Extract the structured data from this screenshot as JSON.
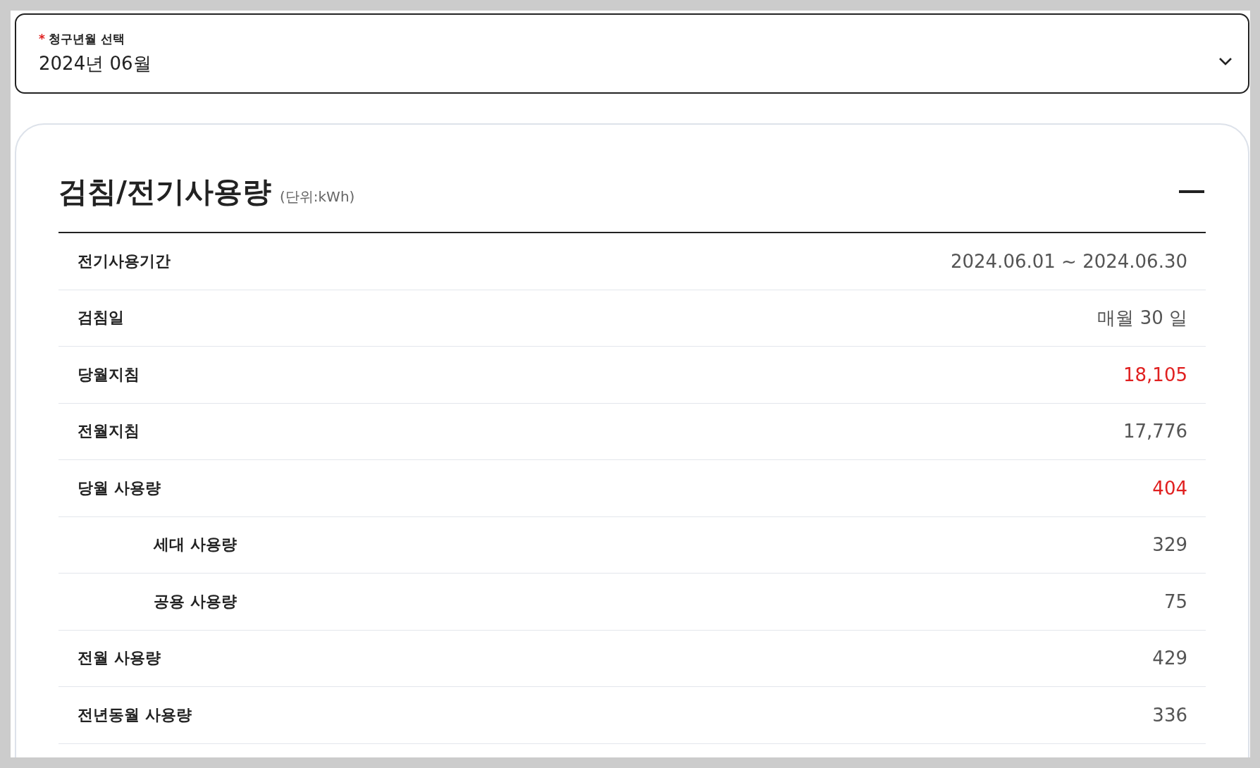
{
  "billing_month_select": {
    "required_mark": "*",
    "label": "청구년월 선택",
    "value": "2024년 06월"
  },
  "usage_panel": {
    "title": "검침/전기사용량",
    "unit": "(단위:kWh)",
    "expanded": true,
    "rows": [
      {
        "label": "전기사용기간",
        "value": "2024.06.01 ~ 2024.06.30",
        "kind": "main",
        "highlighted": false
      },
      {
        "label": "검침일",
        "value": "매월 30 일",
        "kind": "main",
        "highlighted": false
      },
      {
        "label": "당월지침",
        "value": "18,105",
        "kind": "main",
        "highlighted": true
      },
      {
        "label": "전월지침",
        "value": "17,776",
        "kind": "main",
        "highlighted": false
      },
      {
        "label": "당월 사용량",
        "value": "404",
        "kind": "main",
        "highlighted": true
      },
      {
        "label": "세대 사용량",
        "value": "329",
        "kind": "sub",
        "highlighted": false
      },
      {
        "label": "공용 사용량",
        "value": "75",
        "kind": "sub",
        "highlighted": false
      },
      {
        "label": "전월 사용량",
        "value": "429",
        "kind": "main",
        "highlighted": false
      },
      {
        "label": "전년동월 사용량",
        "value": "336",
        "kind": "main",
        "highlighted": false
      }
    ]
  }
}
